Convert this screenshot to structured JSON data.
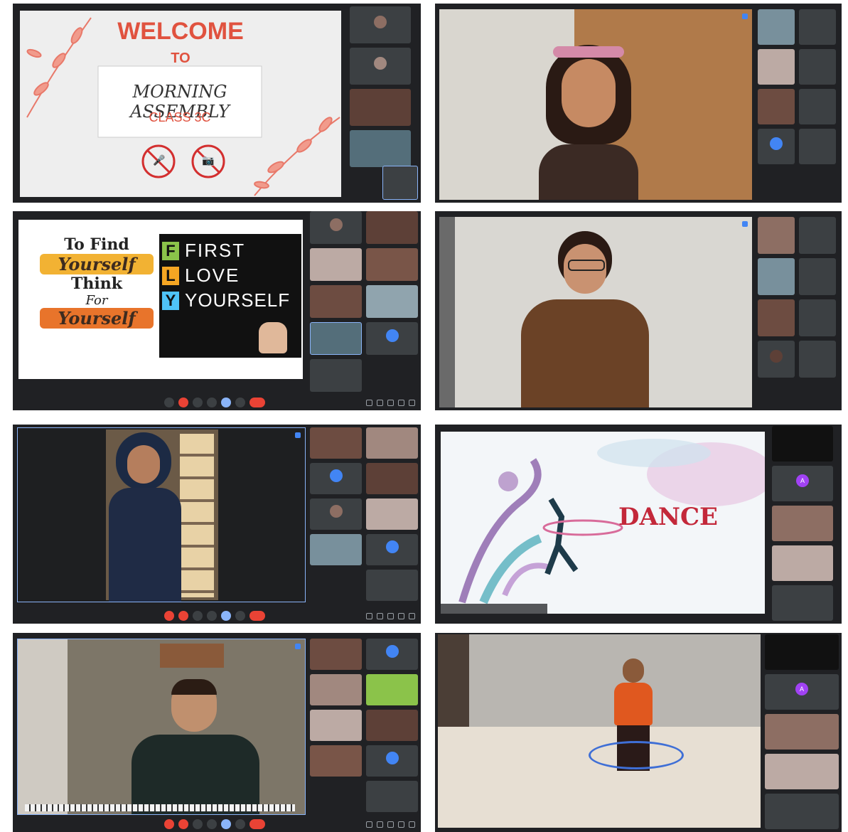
{
  "welcome_slide": {
    "line1": "WELCOME",
    "line2": "TO",
    "line3": "MORNING ASSEMBLY",
    "line4": "CLASS 3C"
  },
  "fly_slide": {
    "find_line1": "To Find",
    "find_line2": "Yourself",
    "find_line3": "Think",
    "find_line4": "For",
    "find_line5": "Yourself",
    "rows": [
      {
        "letter": "F",
        "word": "FIRST",
        "color": "#8bc34a"
      },
      {
        "letter": "L",
        "word": "LOVE",
        "color": "#f5a623"
      },
      {
        "letter": "Y",
        "word": "YOURSELF",
        "color": "#4fc3f7"
      }
    ]
  },
  "dance_slide": {
    "title": "DANCE"
  },
  "avatars": {
    "a_letter": "A",
    "a_color": "#a142f4"
  },
  "colors": {
    "meet_bg": "#202124",
    "tile_bg": "#3c4043",
    "end_call": "#ea4335",
    "accent_blue": "#8ab4f8",
    "welcome_red": "#e0523f"
  }
}
